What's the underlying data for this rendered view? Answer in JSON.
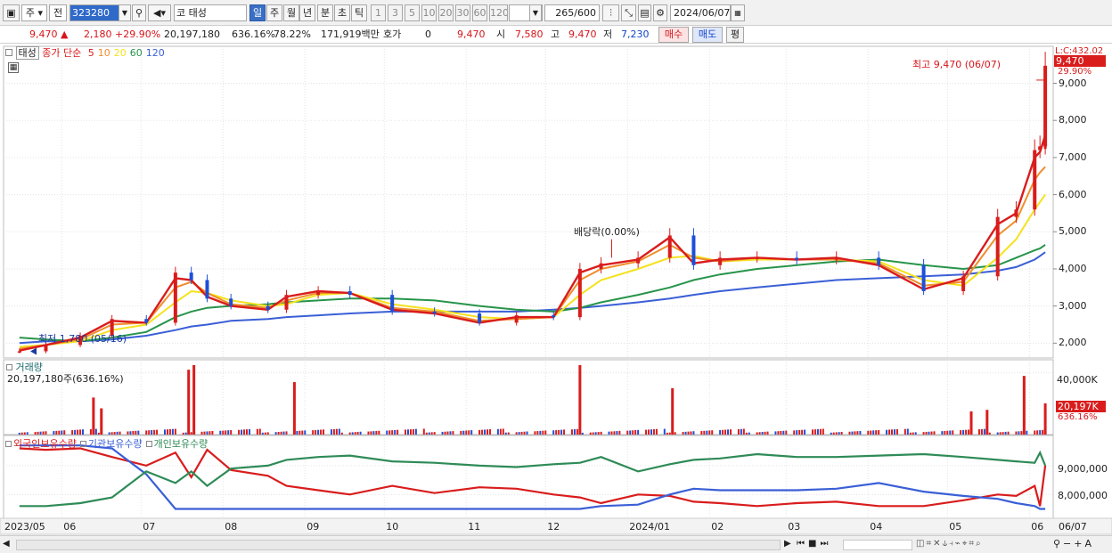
{
  "toolbar": {
    "market_label": "주",
    "prev_label": "전",
    "stock_code": "323280",
    "market_type": "코",
    "stock_name": "태성",
    "period_tabs": [
      "일",
      "주",
      "월",
      "년",
      "분",
      "초",
      "틱"
    ],
    "interval_buttons": [
      "1",
      "3",
      "5",
      "10",
      "20",
      "30",
      "60",
      "120"
    ],
    "count_value": "265",
    "count_total": "/600",
    "date_value": "2024/06/07"
  },
  "quote": {
    "price": "9,470",
    "change": "2,180",
    "change_pct": "+29.90%",
    "volume": "20,197,180",
    "volume_ratio": "636.16%",
    "turnover": "78.22%",
    "amount": "171,919백만",
    "hoga_label": "호가",
    "hoga_value": "0",
    "hoga_price": "9,470",
    "open_label": "시",
    "open": "7,580",
    "high_label": "고",
    "high": "9,470",
    "low_label": "저",
    "low": "7,230",
    "buy_label": "매수",
    "sell_label": "매도",
    "eval_label": "평"
  },
  "legend": {
    "name": "태성",
    "ma_title": "종가 단순",
    "ma_periods": [
      "5",
      "10",
      "20",
      "60",
      "120"
    ],
    "ma_colors": [
      "#d91c1c",
      "#ef8e2b",
      "#f4e21e",
      "#27944a",
      "#3a5fd6"
    ]
  },
  "annotations": {
    "high_note": "최고 9,470 (06/07)",
    "low_note": "최저 1,780 (05/16)",
    "dividend_note": "배당락(0.00%)",
    "last_price_tag": "9,470",
    "last_pct_tag": "29.90%",
    "top_clip": "L:C:432.02"
  },
  "volume_panel": {
    "title": "거래량",
    "value_text": "20,197,180주(636.16%)",
    "axis_label": "40,000K",
    "last_tag": "20,197K",
    "last_pct": "636.16%"
  },
  "holding_panel": {
    "series_names": [
      "외국인보유수량",
      "기관보유수량",
      "개인보유수량"
    ],
    "series_colors": [
      "#d91c1c",
      "#3a5fd6",
      "#2e8b57"
    ],
    "axis_labels": [
      "9,000,000",
      "8,000,000"
    ]
  },
  "colors": {
    "up": "#d91c1c",
    "down": "#1d4fd8",
    "grid": "#e3e3e3",
    "axis_bg": "#ffffff"
  },
  "chart_data": {
    "type": "line",
    "price_axis": {
      "ticks": [
        2000,
        3000,
        4000,
        5000,
        6000,
        7000,
        8000,
        9000
      ],
      "tick_labels": [
        "2,000",
        "3,000",
        "4,000",
        "5,000",
        "6,000",
        "7,000",
        "8,000",
        "9,000"
      ],
      "ylim": [
        1600,
        9900
      ]
    },
    "x_labels": [
      "2023/05",
      "06",
      "07",
      "08",
      "09",
      "10",
      "11",
      "12",
      "2024/01",
      "02",
      "03",
      "04",
      "05",
      "06",
      "06/07"
    ],
    "price": {
      "dates": [
        "2023-05-16",
        "2023-05-26",
        "2023-06-08",
        "2023-06-20",
        "2023-07-03",
        "2023-07-14",
        "2023-07-20",
        "2023-07-26",
        "2023-08-04",
        "2023-08-18",
        "2023-08-25",
        "2023-09-06",
        "2023-09-18",
        "2023-10-04",
        "2023-10-20",
        "2023-11-06",
        "2023-11-20",
        "2023-12-04",
        "2023-12-14",
        "2023-12-22",
        "2024-01-05",
        "2024-01-17",
        "2024-01-26",
        "2024-02-05",
        "2024-02-19",
        "2024-03-05",
        "2024-03-20",
        "2024-04-05",
        "2024-04-22",
        "2024-05-07",
        "2024-05-20",
        "2024-05-27",
        "2024-06-03",
        "2024-06-05",
        "2024-06-07"
      ],
      "close": [
        1780,
        1950,
        2200,
        2650,
        2550,
        3900,
        3700,
        3200,
        3000,
        2900,
        3300,
        3400,
        3300,
        2850,
        2800,
        2550,
        2750,
        2700,
        4000,
        4150,
        4300,
        4900,
        4100,
        4300,
        4300,
        4250,
        4300,
        4100,
        3400,
        3800,
        5400,
        5600,
        7200,
        7300,
        9470
      ]
    },
    "moving_averages": [
      {
        "name": "5",
        "values": [
          1800,
          1950,
          2150,
          2600,
          2550,
          3750,
          3700,
          3250,
          3000,
          2900,
          3250,
          3400,
          3350,
          2900,
          2800,
          2550,
          2700,
          2700,
          3900,
          4100,
          4250,
          4850,
          4150,
          4250,
          4300,
          4250,
          4300,
          4100,
          3450,
          3750,
          5200,
          5500,
          7000,
          7150,
          7600
        ]
      },
      {
        "name": "10",
        "values": [
          1850,
          1950,
          2100,
          2500,
          2550,
          3500,
          3650,
          3350,
          3050,
          2950,
          3150,
          3350,
          3350,
          2950,
          2850,
          2600,
          2650,
          2700,
          3700,
          4000,
          4200,
          4650,
          4300,
          4200,
          4300,
          4250,
          4250,
          4150,
          3550,
          3650,
          4900,
          5300,
          6400,
          6600,
          6750
        ]
      },
      {
        "name": "20",
        "values": [
          1900,
          1950,
          2050,
          2350,
          2500,
          3100,
          3400,
          3350,
          3150,
          3000,
          3050,
          3300,
          3350,
          3050,
          2900,
          2700,
          2650,
          2700,
          3300,
          3700,
          4000,
          4300,
          4350,
          4200,
          4250,
          4250,
          4250,
          4200,
          3700,
          3550,
          4300,
          4800,
          5600,
          5800,
          6000
        ]
      },
      {
        "name": "60",
        "values": [
          2150,
          2100,
          2050,
          2150,
          2300,
          2700,
          2850,
          2950,
          3000,
          3050,
          3100,
          3150,
          3200,
          3200,
          3150,
          3000,
          2900,
          2850,
          2950,
          3100,
          3300,
          3500,
          3700,
          3850,
          4000,
          4100,
          4200,
          4250,
          4100,
          4000,
          4100,
          4300,
          4500,
          4550,
          4650
        ]
      },
      {
        "name": "120",
        "values": [
          2000,
          2050,
          2050,
          2100,
          2200,
          2350,
          2450,
          2500,
          2600,
          2650,
          2700,
          2750,
          2800,
          2850,
          2850,
          2850,
          2850,
          2900,
          2950,
          3000,
          3100,
          3200,
          3300,
          3400,
          3500,
          3600,
          3700,
          3750,
          3800,
          3850,
          3950,
          4050,
          4250,
          4350,
          4450
        ]
      }
    ],
    "volume": {
      "ylim": [
        0,
        45000
      ],
      "spikes": [
        {
          "date": "2023-06-13",
          "value": 24000
        },
        {
          "date": "2023-06-16",
          "value": 17000
        },
        {
          "date": "2023-07-19",
          "value": 42000
        },
        {
          "date": "2023-07-21",
          "value": 47000
        },
        {
          "date": "2023-08-28",
          "value": 34000
        },
        {
          "date": "2023-12-14",
          "value": 46000
        },
        {
          "date": "2024-01-18",
          "value": 30000
        },
        {
          "date": "2024-05-10",
          "value": 15000
        },
        {
          "date": "2024-05-16",
          "value": 16000
        },
        {
          "date": "2024-05-30",
          "value": 38000
        },
        {
          "date": "2024-06-07",
          "value": 20197
        }
      ]
    },
    "holdings": {
      "ylim": [
        7300000,
        9800000
      ],
      "series": [
        {
          "name": "외국인보유수량",
          "values": [
            9600000,
            9550000,
            9600000,
            9300000,
            9000000,
            9450000,
            8600000,
            9550000,
            8850000,
            8650000,
            8300000,
            8150000,
            8000000,
            8300000,
            8050000,
            8250000,
            8200000,
            8000000,
            7900000,
            7700000,
            8000000,
            7950000,
            7750000,
            7700000,
            7600000,
            7700000,
            7750000,
            7600000,
            7600000,
            7800000,
            8000000,
            7950000,
            8300000,
            7600000,
            9000000
          ]
        },
        {
          "name": "기관보유수량",
          "values": [
            9700000,
            9700000,
            9700000,
            9600000,
            8700000,
            7500000,
            7500000,
            7500000,
            7500000,
            7500000,
            7500000,
            7500000,
            7500000,
            7500000,
            7500000,
            7500000,
            7500000,
            7500000,
            7500000,
            7600000,
            7650000,
            8000000,
            8200000,
            8150000,
            8150000,
            8150000,
            8200000,
            8400000,
            8100000,
            7950000,
            7850000,
            7700000,
            7600000,
            7500000,
            7500000
          ]
        },
        {
          "name": "개인보유수량",
          "values": [
            7600000,
            7600000,
            7700000,
            7900000,
            8800000,
            8400000,
            8800000,
            8300000,
            8900000,
            9000000,
            9200000,
            9300000,
            9350000,
            9150000,
            9100000,
            9000000,
            8950000,
            9050000,
            9100000,
            9300000,
            8800000,
            9050000,
            9200000,
            9250000,
            9400000,
            9300000,
            9300000,
            9350000,
            9400000,
            9300000,
            9200000,
            9150000,
            9100000,
            9450000,
            9000000
          ]
        }
      ]
    }
  }
}
